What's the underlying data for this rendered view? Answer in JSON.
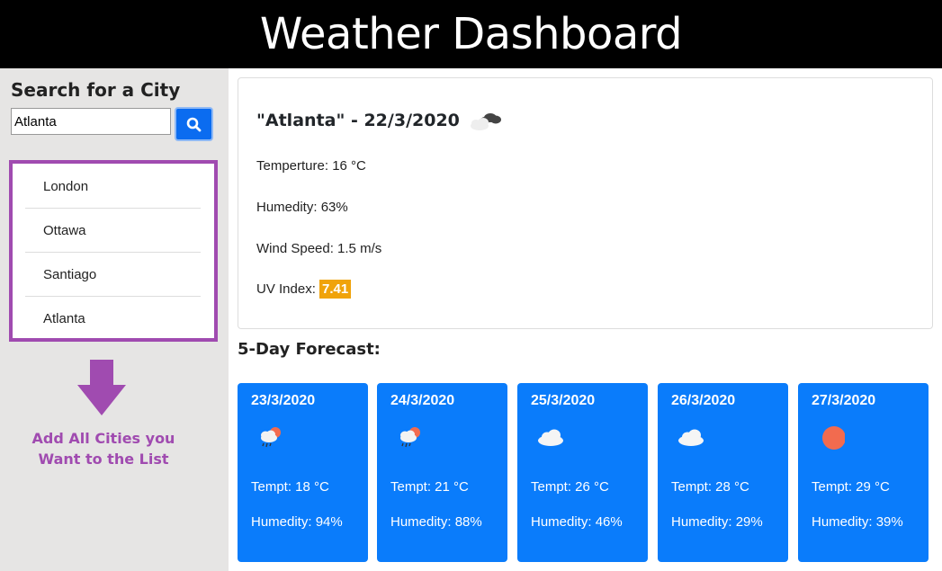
{
  "header": {
    "title": "Weather Dashboard"
  },
  "sidebar": {
    "search_title": "Search for a City",
    "search_value": "Atlanta",
    "search_icon": "search-icon",
    "cities": [
      {
        "label": "London"
      },
      {
        "label": "Ottawa"
      },
      {
        "label": "Santiago"
      },
      {
        "label": "Atlanta"
      }
    ],
    "hint_line1": "Add All Cities you",
    "hint_line2": "Want to the List"
  },
  "current": {
    "title": "\"Atlanta\" - 22/3/2020",
    "icon": "broken-clouds-icon",
    "temperature": "Temperture: 16 °C",
    "humidity": "Humedity: 63%",
    "wind": "Wind Speed: 1.5 m/s",
    "uv_label": "UV Index:",
    "uv_value": "7.41"
  },
  "forecast": {
    "title": "5-Day Forecast:",
    "days": [
      {
        "date": "23/3/2020",
        "icon": "rain-cloud-sun-icon",
        "temp": "Tempt: 18 °C",
        "humidity": "Humedity: 94%"
      },
      {
        "date": "24/3/2020",
        "icon": "rain-cloud-sun-icon",
        "temp": "Tempt: 21 °C",
        "humidity": "Humedity: 88%"
      },
      {
        "date": "25/3/2020",
        "icon": "cloud-icon",
        "temp": "Tempt: 26 °C",
        "humidity": "Humedity: 46%"
      },
      {
        "date": "26/3/2020",
        "icon": "cloud-icon",
        "temp": "Tempt: 28 °C",
        "humidity": "Humedity: 29%"
      },
      {
        "date": "27/3/2020",
        "icon": "sun-icon",
        "temp": "Tempt: 29 °C",
        "humidity": "Humedity: 39%"
      }
    ]
  },
  "colors": {
    "header_bg": "#000000",
    "sidebar_bg": "#e6e5e4",
    "accent_purple": "#a04bb0",
    "button_blue": "#0b6cf0",
    "card_blue": "#0a7cfb",
    "uv_orange": "#f0a30a"
  }
}
